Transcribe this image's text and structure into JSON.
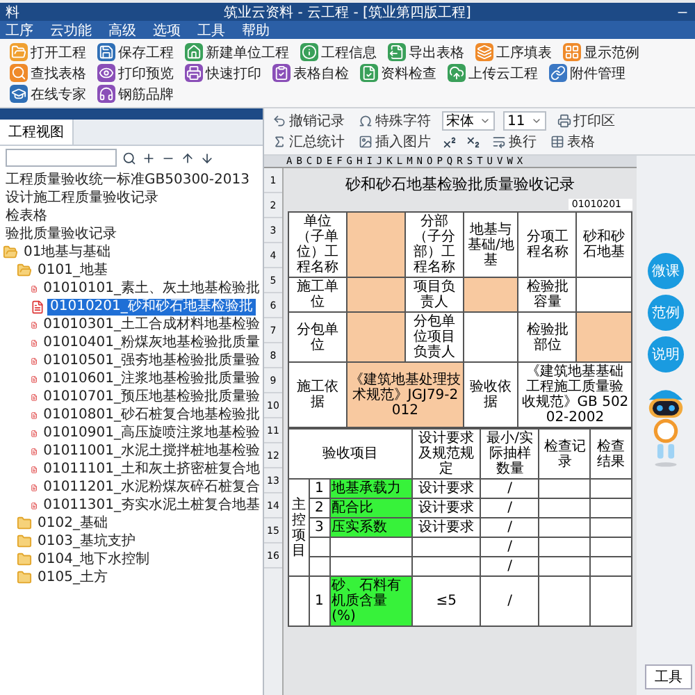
{
  "window": {
    "app_label": "料",
    "title": "筑业云资料 - 云工程 - [筑业第四版工程]"
  },
  "menu": [
    "工序",
    "云功能",
    "高级",
    "选项",
    "工具",
    "帮助"
  ],
  "toolbar": [
    "打开工程",
    "保存工程",
    "新建单位工程",
    "工程信息",
    "导出表格",
    "工序填表",
    "显示范例",
    "查找表格",
    "打印预览",
    "快速打印",
    "表格自检",
    "资料检查",
    "上传云工程",
    "附件管理",
    "在线专家",
    "钢筋品牌"
  ],
  "left_panel": {
    "tab": "工程视图",
    "tree": [
      {
        "kind": "text",
        "label": "工程质量验收统一标准GB50300-2013"
      },
      {
        "kind": "text",
        "label": "设计施工程质量验收记录"
      },
      {
        "kind": "text",
        "label": "检表格"
      },
      {
        "kind": "text",
        "label": "验批质量验收记录"
      },
      {
        "kind": "folder",
        "label": "01地基与基础",
        "expanded": true,
        "children": [
          {
            "kind": "folder",
            "label": "0101_地基",
            "expanded": true,
            "children": [
              {
                "kind": "form",
                "label": "01010101_素土、灰土地基检验批",
                "selected": false
              },
              {
                "kind": "form",
                "label": "01010201_砂和砂石地基检验批",
                "selected": true
              },
              {
                "kind": "form",
                "label": "01010301_土工合成材料地基检验",
                "selected": false
              },
              {
                "kind": "form",
                "label": "01010401_粉煤灰地基检验批质量",
                "selected": false
              },
              {
                "kind": "form",
                "label": "01010501_强夯地基检验批质量验",
                "selected": false
              },
              {
                "kind": "form",
                "label": "01010601_注浆地基检验批质量验",
                "selected": false
              },
              {
                "kind": "form",
                "label": "01010701_预压地基检验批质量验",
                "selected": false
              },
              {
                "kind": "form",
                "label": "01010801_砂石桩复合地基检验批",
                "selected": false
              },
              {
                "kind": "form",
                "label": "01010901_高压旋喷注浆地基检验",
                "selected": false
              },
              {
                "kind": "form",
                "label": "01011001_水泥土搅拌桩地基检验",
                "selected": false
              },
              {
                "kind": "form",
                "label": "01011101_土和灰土挤密桩复合地",
                "selected": false
              },
              {
                "kind": "form",
                "label": "01011201_水泥粉煤灰碎石桩复合",
                "selected": false
              },
              {
                "kind": "form",
                "label": "01011301_夯实水泥土桩复合地基",
                "selected": false
              }
            ]
          },
          {
            "kind": "folder",
            "label": "0102_基础",
            "expanded": false
          },
          {
            "kind": "folder",
            "label": "0103_基坑支护",
            "expanded": false
          },
          {
            "kind": "folder",
            "label": "0104_地下水控制",
            "expanded": false
          },
          {
            "kind": "folder",
            "label": "0105_土方",
            "expanded": false
          }
        ]
      }
    ]
  },
  "format_toolbar": [
    [
      {
        "kind": "button",
        "label": "撤销记录"
      },
      {
        "kind": "button",
        "label": "特殊字符"
      },
      {
        "kind": "combo",
        "value": "宋体"
      },
      {
        "kind": "combo",
        "value": "11"
      },
      {
        "kind": "button",
        "label": "打印区"
      }
    ],
    [
      {
        "kind": "button",
        "label": "汇总统计"
      },
      {
        "kind": "button",
        "label": "插入图片"
      },
      {
        "kind": "superscript"
      },
      {
        "kind": "subscript"
      },
      {
        "kind": "button",
        "label": "换行"
      },
      {
        "kind": "button",
        "label": "表格"
      }
    ]
  ],
  "sheet": {
    "columns": "ABCDEFGHIJKLMNOPQRSTUVWX",
    "row_numbers": [
      "1",
      "2",
      "3",
      "4",
      "5",
      "6",
      "7",
      "8",
      "9",
      "10",
      "11",
      "12",
      "13",
      "14",
      "15",
      "16"
    ],
    "title": "砂和砂石地基检验批质量验收记录",
    "code": "01010201",
    "header_rows": [
      [
        {
          "kind": "label",
          "text": "单位（子单位）工程名称"
        },
        {
          "kind": "value",
          "highlighted": true
        },
        {
          "kind": "label",
          "text": "分部（子分部）工程名称"
        },
        {
          "kind": "value",
          "text": "地基与基础/地基",
          "highlighted": false
        },
        {
          "kind": "label",
          "text": "分项工程名称"
        },
        {
          "kind": "value",
          "text": "砂和砂石地基",
          "highlighted": false
        }
      ],
      [
        {
          "kind": "label",
          "text": "施工单位"
        },
        {
          "kind": "value",
          "highlighted": true
        },
        {
          "kind": "label",
          "text": "项目负责人"
        },
        {
          "kind": "value",
          "highlighted": true
        },
        {
          "kind": "label",
          "text": "检验批容量"
        },
        {
          "kind": "value",
          "highlighted": false
        }
      ],
      [
        {
          "kind": "label",
          "text": "分包单位"
        },
        {
          "kind": "value",
          "highlighted": true
        },
        {
          "kind": "label",
          "text": "分包单位项目负责人"
        },
        {
          "kind": "value",
          "highlighted": false
        },
        {
          "kind": "label",
          "text": "检验批部位"
        },
        {
          "kind": "value",
          "highlighted": true
        }
      ],
      [
        {
          "kind": "label",
          "text": "施工依据"
        },
        {
          "kind": "value",
          "text": "《建筑地基处理技术规范》JGJ79-2012",
          "highlighted": true
        },
        {
          "kind": "label",
          "text": "验收依据"
        },
        {
          "kind": "value",
          "text": "《建筑地基基础工程施工质量验收规范》GB 50202-2002",
          "highlighted": false
        }
      ]
    ],
    "item_headers": [
      "验收项目",
      "设计要求及规范规定",
      "最小/实际抽样数量",
      "检查记录",
      "检查结果"
    ],
    "sections": [
      {
        "label": "主控项目",
        "rows": [
          {
            "no": "1",
            "item": "地基承载力",
            "requirement": "设计要求",
            "sample": "/",
            "highlighted": true
          },
          {
            "no": "2",
            "item": "配合比",
            "requirement": "设计要求",
            "sample": "/",
            "highlighted": true
          },
          {
            "no": "3",
            "item": "压实系数",
            "requirement": "设计要求",
            "sample": "/",
            "highlighted": true
          },
          {
            "sample": "/",
            "highlighted": false
          },
          {
            "sample": "/",
            "highlighted": false
          }
        ]
      },
      {
        "rows": [
          {
            "no": "1",
            "item": "砂、石料有机质含量(%)",
            "requirement": "≤5",
            "sample": "/",
            "highlighted": true
          }
        ]
      }
    ]
  },
  "assistant": {
    "bubbles": [
      "微课",
      "范例",
      "说明"
    ],
    "tool_button": "工具"
  }
}
